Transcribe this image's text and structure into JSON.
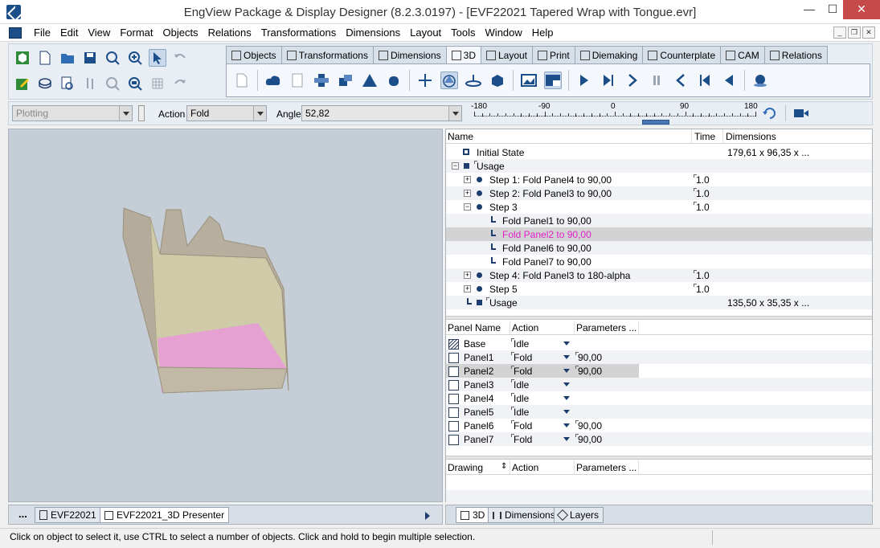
{
  "window": {
    "title": "EngView Package & Display Designer (8.2.3.0197) - [EVF22021 Tapered Wrap with Tongue.evr]",
    "minimize": "—",
    "maximize": "☐",
    "close": "✕"
  },
  "menu": {
    "items": [
      "File",
      "Edit",
      "View",
      "Format",
      "Objects",
      "Relations",
      "Transformations",
      "Dimensions",
      "Layout",
      "Tools",
      "Window",
      "Help"
    ]
  },
  "ribbon": {
    "tabs": [
      "Objects",
      "Transformations",
      "Dimensions",
      "3D",
      "Layout",
      "Print",
      "Diemaking",
      "Counterplate",
      "CAM",
      "Relations"
    ],
    "active_tab": "3D"
  },
  "options": {
    "mode_combo": "Plotting",
    "action_label": "Action",
    "action_value": "Fold",
    "angle_label": "Angle",
    "angle_value": "52,82",
    "slider_ticks": [
      "-180",
      "-90",
      "0",
      "90",
      "180"
    ],
    "slider_value": 52.82
  },
  "steps_grid": {
    "headers": [
      "Name",
      "Time",
      "Dimensions"
    ],
    "rows": [
      {
        "name": "Initial State",
        "time": "",
        "dims": "179,61 x 96,35 x ..."
      },
      {
        "name": "Usage",
        "time": "",
        "dims": ""
      },
      {
        "name": "Step 1: Fold Panel4 to 90,00",
        "time": "1.0",
        "dims": ""
      },
      {
        "name": "Step 2: Fold Panel3 to 90,00",
        "time": "1.0",
        "dims": ""
      },
      {
        "name": "Step 3",
        "time": "1.0",
        "dims": ""
      },
      {
        "name": "Fold Panel1 to 90,00",
        "time": "",
        "dims": ""
      },
      {
        "name": "Fold Panel2 to 90,00",
        "time": "",
        "dims": ""
      },
      {
        "name": "Fold Panel6 to 90,00",
        "time": "",
        "dims": ""
      },
      {
        "name": "Fold Panel7 to 90,00",
        "time": "",
        "dims": ""
      },
      {
        "name": "Step 4: Fold Panel3 to 180-alpha",
        "time": "1.0",
        "dims": ""
      },
      {
        "name": "Step 5",
        "time": "1.0",
        "dims": ""
      },
      {
        "name": "Usage",
        "time": "",
        "dims": "135,50 x 35,35 x ..."
      }
    ],
    "highlight_color": "#e020c8"
  },
  "panels_grid": {
    "headers": [
      "Panel Name",
      "Action",
      "Parameters ..."
    ],
    "rows": [
      {
        "name": "Base",
        "action": "Idle",
        "param": ""
      },
      {
        "name": "Panel1",
        "action": "Fold",
        "param": "90,00"
      },
      {
        "name": "Panel2",
        "action": "Fold",
        "param": "90,00"
      },
      {
        "name": "Panel3",
        "action": "Idle",
        "param": ""
      },
      {
        "name": "Panel4",
        "action": "Idle",
        "param": ""
      },
      {
        "name": "Panel5",
        "action": "Idle",
        "param": ""
      },
      {
        "name": "Panel6",
        "action": "Fold",
        "param": "90,00"
      },
      {
        "name": "Panel7",
        "action": "Fold",
        "param": "90,00"
      }
    ]
  },
  "drawing_grid": {
    "headers": [
      "Drawing",
      "Action",
      "Parameters ..."
    ]
  },
  "doc_tabs": {
    "more": "...",
    "tabs": [
      "EVF22021",
      "EVF22021_3D Presenter"
    ]
  },
  "right_tabs": [
    "3D",
    "Dimensions",
    "Layers"
  ],
  "status": {
    "text": "Click on object to select it, use CTRL to select a number of objects. Click and hold to begin multiple selection."
  }
}
